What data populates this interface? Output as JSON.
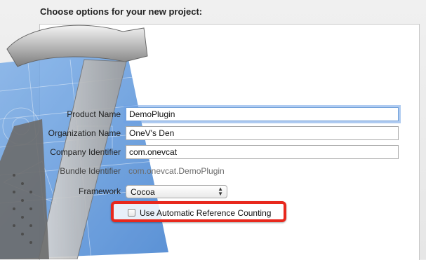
{
  "heading": "Choose options for your new project:",
  "fields": {
    "product_name": {
      "label": "Product Name",
      "value": "DemoPlugin"
    },
    "organization_name": {
      "label": "Organization Name",
      "value": "OneV's Den"
    },
    "company_identifier": {
      "label": "Company Identifier",
      "value": "com.onevcat"
    },
    "bundle_identifier": {
      "label": "Bundle Identifier",
      "value": "com.onevcat.DemoPlugin"
    },
    "framework": {
      "label": "Framework",
      "selected": "Cocoa"
    }
  },
  "options": {
    "arc_checkbox": {
      "label": "Use Automatic Reference Counting",
      "checked": false
    }
  },
  "colors": {
    "highlight": "#e8281d",
    "focus_ring": "#6f9fd8"
  },
  "icons": [
    "xcode-hammer-icon",
    "blueprint-artwork",
    "select-arrows-icon",
    "checkbox-icon"
  ]
}
